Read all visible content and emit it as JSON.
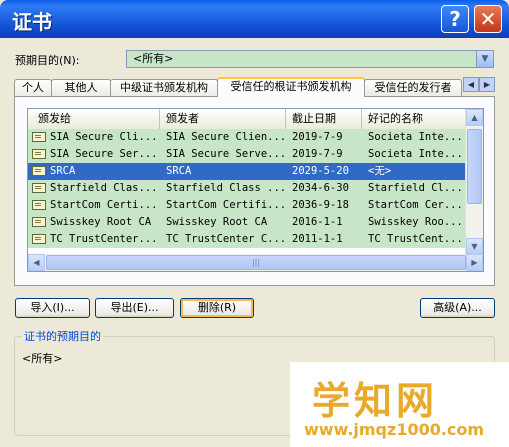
{
  "window": {
    "title": "证书"
  },
  "purpose": {
    "label": "预期目的(N):",
    "value": "<所有>"
  },
  "tabs": [
    {
      "label": "个人"
    },
    {
      "label": "其他人"
    },
    {
      "label": "中级证书颁发机构"
    },
    {
      "label": "受信任的根证书颁发机构",
      "active": true
    },
    {
      "label": "受信任的发行者"
    }
  ],
  "table": {
    "columns": [
      "颁发给",
      "颁发者",
      "截止日期",
      "好记的名称"
    ],
    "rows": [
      [
        "SIA Secure Cli...",
        "SIA Secure Clien...",
        "2019-7-9",
        "Societa Inte..."
      ],
      [
        "SIA Secure Ser...",
        "SIA Secure Serve...",
        "2019-7-9",
        "Societa Inte..."
      ],
      [
        "SRCA",
        "SRCA",
        "2029-5-20",
        "<无>"
      ],
      [
        "Starfield Clas...",
        "Starfield Class ...",
        "2034-6-30",
        "Starfield Cl..."
      ],
      [
        "StartCom Certi...",
        "StartCom Certifi...",
        "2036-9-18",
        "StartCom Cer..."
      ],
      [
        "Swisskey Root CA",
        "Swisskey Root CA",
        "2016-1-1",
        "Swisskey Roo..."
      ],
      [
        "TC TrustCenter...",
        "TC TrustCenter C...",
        "2011-1-1",
        "TC TrustCent..."
      ]
    ],
    "selected_row": 2
  },
  "buttons": {
    "import": "导入(I)...",
    "export": "导出(E)...",
    "delete": "删除(R)",
    "advanced": "高级(A)..."
  },
  "cert_purpose": {
    "title": "证书的预期目的",
    "value": "<所有>"
  },
  "watermark": {
    "title": "学知网",
    "url": "www.jmqz1000.com"
  },
  "colors": {
    "row_bg": "#C7E6C7",
    "selected_bg": "#316AC5",
    "title_bar": "#0A5CE8"
  }
}
